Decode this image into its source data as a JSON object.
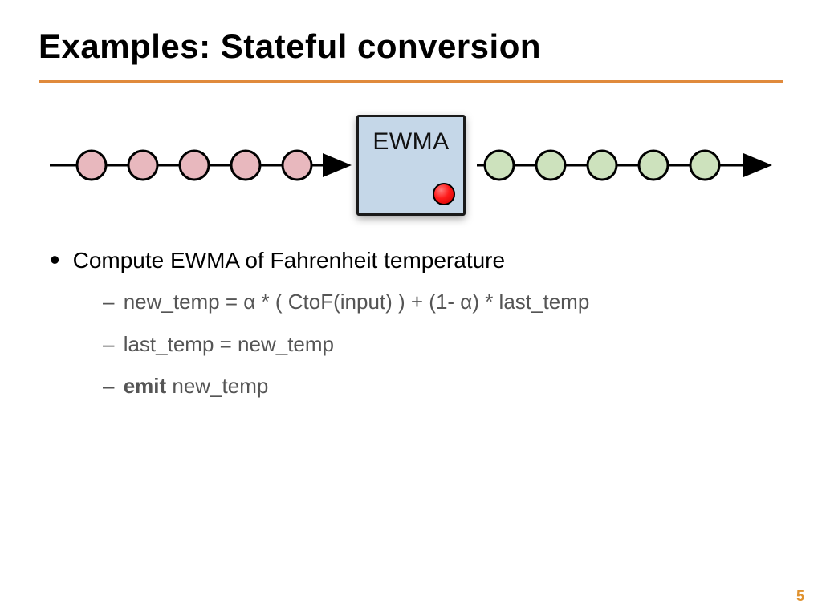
{
  "title": "Examples:  Stateful conversion",
  "diagram": {
    "box_label": "EWMA",
    "input_circle_count": 5,
    "output_circle_count": 5,
    "input_color": "#e8b8be",
    "output_color": "#cde2bd",
    "stroke": "#000000"
  },
  "bullets": {
    "b1": "Compute EWMA of Fahrenheit temperature",
    "s1": "new_temp = α * ( CtoF(input) ) + (1- α) * last_temp",
    "s2": "last_temp = new_temp",
    "s3_bold": "emit",
    "s3_rest": " new_temp"
  },
  "page": "5"
}
